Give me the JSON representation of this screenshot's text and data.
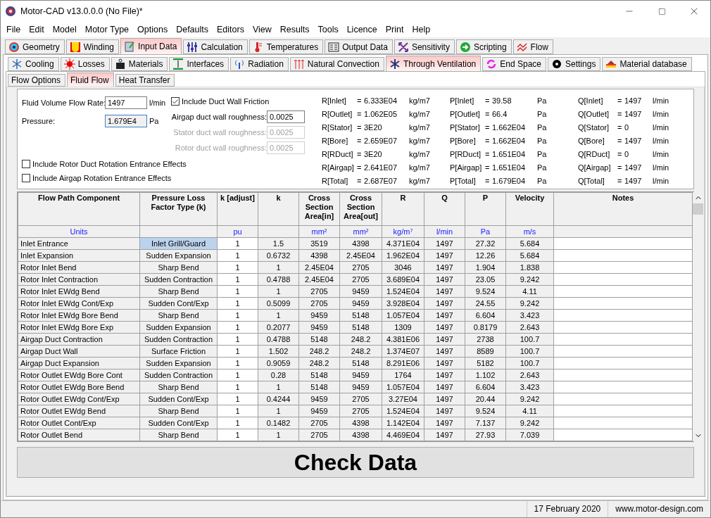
{
  "window": {
    "title": "Motor-CAD v13.0.0.0 (No File)*"
  },
  "menu": [
    "File",
    "Edit",
    "Model",
    "Motor Type",
    "Options",
    "Defaults",
    "Editors",
    "View",
    "Results",
    "Tools",
    "Licence",
    "Print",
    "Help"
  ],
  "main_tabs": [
    {
      "label": "Geometry",
      "selected": false
    },
    {
      "label": "Winding",
      "selected": false
    },
    {
      "label": "Input Data",
      "selected": true
    },
    {
      "label": "Calculation",
      "selected": false
    },
    {
      "label": "Temperatures",
      "selected": false
    },
    {
      "label": "Output Data",
      "selected": false
    },
    {
      "label": "Sensitivity",
      "selected": false
    },
    {
      "label": "Scripting",
      "selected": false
    },
    {
      "label": "Flow",
      "selected": false
    }
  ],
  "sub_tabs": [
    {
      "label": "Cooling",
      "selected": false
    },
    {
      "label": "Losses",
      "selected": false
    },
    {
      "label": "Materials",
      "selected": false
    },
    {
      "label": "Interfaces",
      "selected": false
    },
    {
      "label": "Radiation",
      "selected": false
    },
    {
      "label": "Natural Convection",
      "selected": false
    },
    {
      "label": "Through Ventilation",
      "selected": true
    },
    {
      "label": "End Space",
      "selected": false
    },
    {
      "label": "Settings",
      "selected": false
    },
    {
      "label": "Material database",
      "selected": false
    }
  ],
  "page_tabs": [
    {
      "label": "Flow Options",
      "selected": false
    },
    {
      "label": "Fluid Flow",
      "selected": true
    },
    {
      "label": "Heat Transfer",
      "selected": false
    }
  ],
  "inputs": [
    {
      "label": "Fluid Volume Flow Rate:",
      "value": "1497",
      "unit": "l/min",
      "readonly": false
    },
    {
      "label": "Pressure:",
      "value": "1.679E4",
      "unit": "Pa",
      "readonly": true
    }
  ],
  "duct_friction": {
    "label": "Include Duct Wall Friction",
    "checked": true
  },
  "roughness": [
    {
      "label": "Airgap duct wall roughness:",
      "value": "0.0025",
      "disabled": false
    },
    {
      "label": "Stator duct wall roughness:",
      "value": "0.0025",
      "disabled": true
    },
    {
      "label": "Rotor duct wall roughness:",
      "value": "0.0025",
      "disabled": true
    }
  ],
  "options": [
    {
      "label": "Include Rotor Duct Rotation Entrance Effects",
      "checked": false
    },
    {
      "label": "Include Airgap Rotation Entrance Effects",
      "checked": false
    }
  ],
  "results": [
    [
      {
        "label": "R[Inlet]",
        "eq": "=",
        "value": "6.333E04",
        "unit": "kg/m7"
      },
      {
        "label": "R[Outlet]",
        "eq": "=",
        "value": "1.062E05",
        "unit": "kg/m7"
      },
      {
        "label": "R[Stator]",
        "eq": "=",
        "value": "3E20",
        "unit": "kg/m7"
      },
      {
        "label": "R[Bore]",
        "eq": "=",
        "value": "2.659E07",
        "unit": "kg/m7"
      },
      {
        "label": "R[RDuct]",
        "eq": "=",
        "value": "3E20",
        "unit": "kg/m7"
      },
      {
        "label": "R[Airgap]",
        "eq": "=",
        "value": "2.641E07",
        "unit": "kg/m7"
      },
      {
        "label": "R[Total]",
        "eq": "=",
        "value": "2.687E07",
        "unit": "kg/m7"
      }
    ],
    [
      {
        "label": "P[Inlet]",
        "eq": "=",
        "value": "39.58",
        "unit": "Pa"
      },
      {
        "label": "P[Outlet]",
        "eq": "=",
        "value": "66.4",
        "unit": "Pa"
      },
      {
        "label": "P[Stator]",
        "eq": "=",
        "value": "1.662E04",
        "unit": "Pa"
      },
      {
        "label": "P[Bore]",
        "eq": "=",
        "value": "1.662E04",
        "unit": "Pa"
      },
      {
        "label": "P[RDuct]",
        "eq": "=",
        "value": "1.651E04",
        "unit": "Pa"
      },
      {
        "label": "P[Airgap]",
        "eq": "=",
        "value": "1.651E04",
        "unit": "Pa"
      },
      {
        "label": "P[Total]",
        "eq": "=",
        "value": "1.679E04",
        "unit": "Pa"
      }
    ],
    [
      {
        "label": "Q[Inlet]",
        "eq": "=",
        "value": "1497",
        "unit": "l/min"
      },
      {
        "label": "Q[Outlet]",
        "eq": "=",
        "value": "1497",
        "unit": "l/min"
      },
      {
        "label": "Q[Stator]",
        "eq": "=",
        "value": "0",
        "unit": "l/min"
      },
      {
        "label": "Q[Bore]",
        "eq": "=",
        "value": "1497",
        "unit": "l/min"
      },
      {
        "label": "Q[RDuct]",
        "eq": "=",
        "value": "0",
        "unit": "l/min"
      },
      {
        "label": "Q[Airgap]",
        "eq": "=",
        "value": "1497",
        "unit": "l/min"
      },
      {
        "label": "Q[Total]",
        "eq": "=",
        "value": "1497",
        "unit": "l/min"
      }
    ]
  ],
  "table": {
    "columns": [
      {
        "label": "Flow Path Component",
        "unit": "Units",
        "editable": false
      },
      {
        "label": "Pressure Loss Factor Type (k)",
        "editable": false
      },
      {
        "label": "k [adjust]",
        "unit": "pu",
        "editable": true
      },
      {
        "label": "k",
        "editable": false
      },
      {
        "label": "Cross Section Area[in]",
        "unit": "mm²",
        "editable": false
      },
      {
        "label": "Cross Section Area[out]",
        "unit": "mm²",
        "editable": false
      },
      {
        "label": "R",
        "unit": "kg/m⁷",
        "editable": false
      },
      {
        "label": "Q",
        "unit": "l/min",
        "editable": false
      },
      {
        "label": "P",
        "unit": "Pa",
        "editable": false
      },
      {
        "label": "Velocity",
        "unit": "m/s",
        "editable": false
      },
      {
        "label": "Notes",
        "editable": true
      }
    ],
    "rows": [
      {
        "selected": true,
        "cells": [
          "Inlet Entrance",
          "Inlet Grill/Guard",
          "1",
          "1.5",
          "3519",
          "4398",
          "4.371E04",
          "1497",
          "27.32",
          "5.684",
          ""
        ]
      },
      {
        "selected": false,
        "cells": [
          "Inlet Expansion",
          "Sudden Expansion",
          "1",
          "0.6732",
          "4398",
          "2.45E04",
          "1.962E04",
          "1497",
          "12.26",
          "5.684",
          ""
        ]
      },
      {
        "selected": false,
        "cells": [
          "Rotor Inlet Bend",
          "Sharp Bend",
          "1",
          "1",
          "2.45E04",
          "2705",
          "3046",
          "1497",
          "1.904",
          "1.838",
          ""
        ]
      },
      {
        "selected": false,
        "cells": [
          "Rotor Inlet Contraction",
          "Sudden Contraction",
          "1",
          "0.4788",
          "2.45E04",
          "2705",
          "3.689E04",
          "1497",
          "23.05",
          "9.242",
          ""
        ]
      },
      {
        "selected": false,
        "cells": [
          "Rotor Inlet EWdg Bend",
          "Sharp Bend",
          "1",
          "1",
          "2705",
          "9459",
          "1.524E04",
          "1497",
          "9.524",
          "4.11",
          ""
        ]
      },
      {
        "selected": false,
        "cells": [
          "Rotor Inlet EWdg Cont/Exp",
          "Sudden Cont/Exp",
          "1",
          "0.5099",
          "2705",
          "9459",
          "3.928E04",
          "1497",
          "24.55",
          "9.242",
          ""
        ]
      },
      {
        "selected": false,
        "cells": [
          "Rotor Inlet EWdg Bore Bend",
          "Sharp Bend",
          "1",
          "1",
          "9459",
          "5148",
          "1.057E04",
          "1497",
          "6.604",
          "3.423",
          ""
        ]
      },
      {
        "selected": false,
        "cells": [
          "Rotor Inlet EWdg Bore Exp",
          "Sudden Expansion",
          "1",
          "0.2077",
          "9459",
          "5148",
          "1309",
          "1497",
          "0.8179",
          "2.643",
          ""
        ]
      },
      {
        "selected": false,
        "cells": [
          "Airgap Duct Contraction",
          "Sudden Contraction",
          "1",
          "0.4788",
          "5148",
          "248.2",
          "4.381E06",
          "1497",
          "2738",
          "100.7",
          ""
        ]
      },
      {
        "selected": false,
        "cells": [
          "Airgap Duct Wall",
          "Surface Friction",
          "1",
          "1.502",
          "248.2",
          "248.2",
          "1.374E07",
          "1497",
          "8589",
          "100.7",
          ""
        ]
      },
      {
        "selected": false,
        "cells": [
          "Airgap Duct Expansion",
          "Sudden Expansion",
          "1",
          "0.9059",
          "248.2",
          "5148",
          "8.291E06",
          "1497",
          "5182",
          "100.7",
          ""
        ]
      },
      {
        "selected": false,
        "cells": [
          "Rotor Outlet EWdg Bore Cont",
          "Sudden Contraction",
          "1",
          "0.28",
          "5148",
          "9459",
          "1764",
          "1497",
          "1.102",
          "2.643",
          ""
        ]
      },
      {
        "selected": false,
        "cells": [
          "Rotor Outlet EWdg Bore Bend",
          "Sharp Bend",
          "1",
          "1",
          "5148",
          "9459",
          "1.057E04",
          "1497",
          "6.604",
          "3.423",
          ""
        ]
      },
      {
        "selected": false,
        "cells": [
          "Rotor Outlet EWdg Cont/Exp",
          "Sudden Cont/Exp",
          "1",
          "0.4244",
          "9459",
          "2705",
          "3.27E04",
          "1497",
          "20.44",
          "9.242",
          ""
        ]
      },
      {
        "selected": false,
        "cells": [
          "Rotor Outlet EWdg Bend",
          "Sharp Bend",
          "1",
          "1",
          "9459",
          "2705",
          "1.524E04",
          "1497",
          "9.524",
          "4.11",
          ""
        ]
      },
      {
        "selected": false,
        "cells": [
          "Rotor Outlet Cont/Exp",
          "Sudden Cont/Exp",
          "1",
          "0.1482",
          "2705",
          "4398",
          "1.142E04",
          "1497",
          "7.137",
          "9.242",
          ""
        ]
      },
      {
        "selected": false,
        "cells": [
          "Rotor Outlet Bend",
          "Sharp Bend",
          "1",
          "1",
          "2705",
          "4398",
          "4.469E04",
          "1497",
          "27.93",
          "7.039",
          ""
        ]
      }
    ]
  },
  "check_button": "Check Data",
  "status_bar": [
    "17 February 2020",
    "www.motor-design.com"
  ]
}
